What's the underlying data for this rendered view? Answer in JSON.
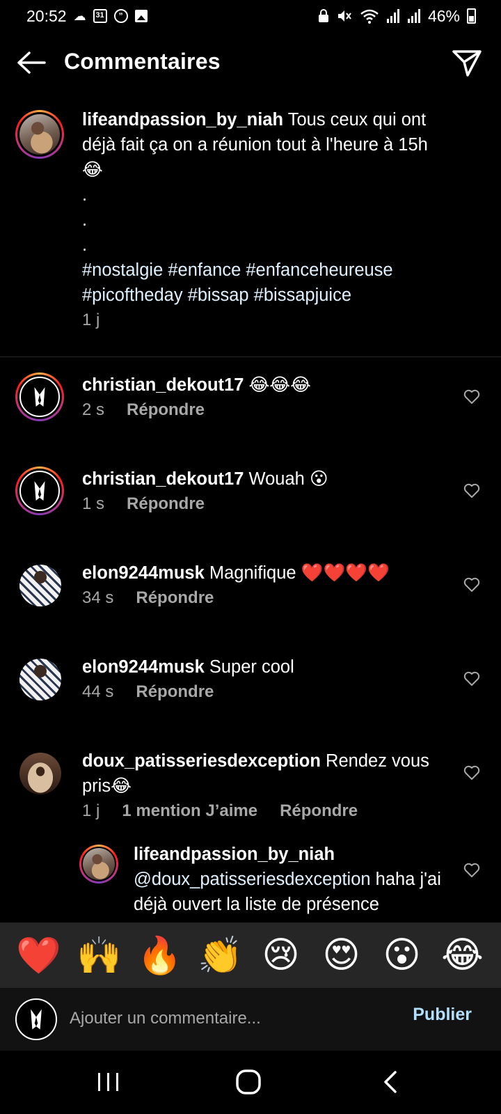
{
  "status_bar": {
    "time": "20:52",
    "calendar_day": "31",
    "battery": "46%"
  },
  "header": {
    "title": "Commentaires"
  },
  "caption": {
    "username": "lifeandpassion_by_niah",
    "text_line1": " Tous ceux qui ont déjà fait ça on a réunion tout à l'heure à 15h ",
    "emoji": "😂",
    "dots": [
      ".",
      ".",
      "."
    ],
    "hashtags": "#nostalgie #enfance #enfanceheureuse #picoftheday #bissap #bissapjuice",
    "time": "1 j"
  },
  "comments": [
    {
      "username": "christian_dekout17",
      "text": " ",
      "emoji": "😂😂😂",
      "time": "2 s",
      "reply": "Répondre"
    },
    {
      "username": "christian_dekout17",
      "text": " Wouah ",
      "emoji": "😮",
      "time": "1 s",
      "reply": "Répondre"
    },
    {
      "username": "elon9244musk",
      "text": " Magnifique ",
      "emoji": "❤️❤️❤️❤️",
      "time": "34 s",
      "reply": "Répondre"
    },
    {
      "username": "elon9244musk",
      "text": " Super cool",
      "emoji": "",
      "time": "44 s",
      "reply": "Répondre"
    },
    {
      "username": "doux_patisseriesdexception",
      "text": " Rendez vous pris",
      "emoji": "😂",
      "time": "1 j",
      "likes": "1 mention J’aime",
      "reply": "Répondre"
    }
  ],
  "reply": {
    "username": "lifeandpassion_by_niah",
    "mention": "@doux_patisseriesdexception",
    "text": " haha j'ai déjà ouvert la liste de présence"
  },
  "emoji_bar": [
    "❤️",
    "🙌",
    "🔥",
    "👏",
    "😢",
    "😍",
    "😮",
    "😂"
  ],
  "input": {
    "placeholder": "Ajouter un commentaire...",
    "publish_label": "Publier"
  },
  "colors": {
    "background": "#000000",
    "secondary_text": "#a8a8a8",
    "publish": "#b2dffc",
    "emoji_bar_bg": "#262626"
  }
}
